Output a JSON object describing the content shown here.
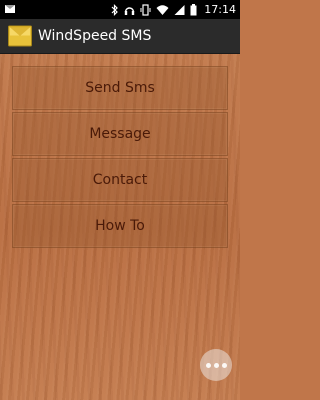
{
  "status_bar": {
    "time": "17:14",
    "left_icon": "notification-icon",
    "icons": [
      "bluetooth-icon",
      "headphones-icon",
      "vibrate-icon",
      "wifi-icon",
      "signal-icon",
      "battery-icon"
    ]
  },
  "action_bar": {
    "title": "WindSpeed SMS",
    "icon": "envelope-icon"
  },
  "menu": {
    "items": [
      {
        "label": "Send Sms"
      },
      {
        "label": "Message"
      },
      {
        "label": "Contact"
      },
      {
        "label": "How To"
      }
    ]
  },
  "overflow_button": {
    "icon": "more-dots-icon"
  },
  "colors": {
    "wood": "#c0764a",
    "button_text": "#4a1a08",
    "action_bar": "#2b2b2b"
  }
}
